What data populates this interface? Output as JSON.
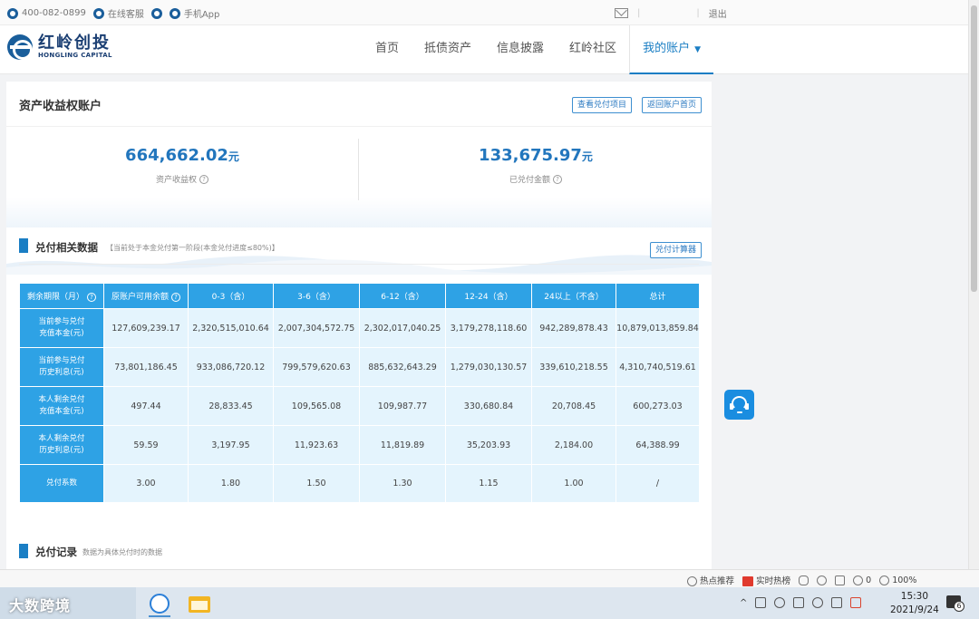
{
  "topbar": {
    "phone": "400-082-0899",
    "online_service": "在线客服",
    "mobile_app": "手机App",
    "logout": "退出"
  },
  "logo": {
    "cn": "红岭创投",
    "en": "HONGLING CAPITAL"
  },
  "nav": {
    "items": [
      {
        "label": "首页"
      },
      {
        "label": "抵债资产"
      },
      {
        "label": "信息披露"
      },
      {
        "label": "红岭社区"
      },
      {
        "label": "我的账户"
      }
    ],
    "active_arrow": "▼"
  },
  "panel": {
    "title": "资产收益权账户",
    "btn_view_projects": "查看兑付项目",
    "btn_back_home": "返回账户首页"
  },
  "summary": {
    "equity_value": "664,662.02",
    "equity_unit": "元",
    "equity_label": "资产收益权",
    "paid_value": "133,675.97",
    "paid_unit": "元",
    "paid_label": "已兑付金额",
    "help_glyph": "?"
  },
  "section_payout": {
    "title": "兑付相关数据",
    "note": "【当前处于本金兑付第一阶段(本金兑付进度≤80%)】",
    "calc_button": "兑付计算器"
  },
  "table": {
    "headers": [
      "剩余期限（月）",
      "原账户可用余额",
      "0-3（含）",
      "3-6（含）",
      "6-12（含）",
      "12-24（含）",
      "24以上（不含）",
      "总计"
    ],
    "rows": [
      {
        "label_l1": "当前参与兑付",
        "label_l2": "充值本金(元)",
        "cells": [
          "127,609,239.17",
          "2,320,515,010.64",
          "2,007,304,572.75",
          "2,302,017,040.25",
          "3,179,278,118.60",
          "942,289,878.43",
          "10,879,013,859.84"
        ]
      },
      {
        "label_l1": "当前参与兑付",
        "label_l2": "历史利息(元)",
        "cells": [
          "73,801,186.45",
          "933,086,720.12",
          "799,579,620.63",
          "885,632,643.29",
          "1,279,030,130.57",
          "339,610,218.55",
          "4,310,740,519.61"
        ]
      },
      {
        "label_l1": "本人剩余兑付",
        "label_l2": "充值本金(元)",
        "cells": [
          "497.44",
          "28,833.45",
          "109,565.08",
          "109,987.77",
          "330,680.84",
          "20,708.45",
          "600,273.03"
        ]
      },
      {
        "label_l1": "本人剩余兑付",
        "label_l2": "历史利息(元)",
        "cells": [
          "59.59",
          "3,197.95",
          "11,923.63",
          "11,819.89",
          "35,203.93",
          "2,184.00",
          "64,388.99"
        ]
      },
      {
        "label_l1": "兑付系数",
        "label_l2": "",
        "cells": [
          "3.00",
          "1.80",
          "1.50",
          "1.30",
          "1.15",
          "1.00",
          "/"
        ]
      }
    ]
  },
  "section_records": {
    "title": "兑付记录",
    "note": "数据为具体兑付时的数据"
  },
  "statusbar": {
    "hot_recommend": "热点推荐",
    "realtime_hot": "实时热榜",
    "badge_count": "0",
    "zoom": "100%"
  },
  "taskbar": {
    "watermark": "大数跨境",
    "time": "15:30",
    "date": "2021/9/24",
    "notification_count": "6"
  },
  "colors": {
    "brand": "#1b3f73",
    "accent": "#1a7ec4",
    "table_header": "#2ea2e5",
    "table_cell": "#e4f4fd"
  }
}
